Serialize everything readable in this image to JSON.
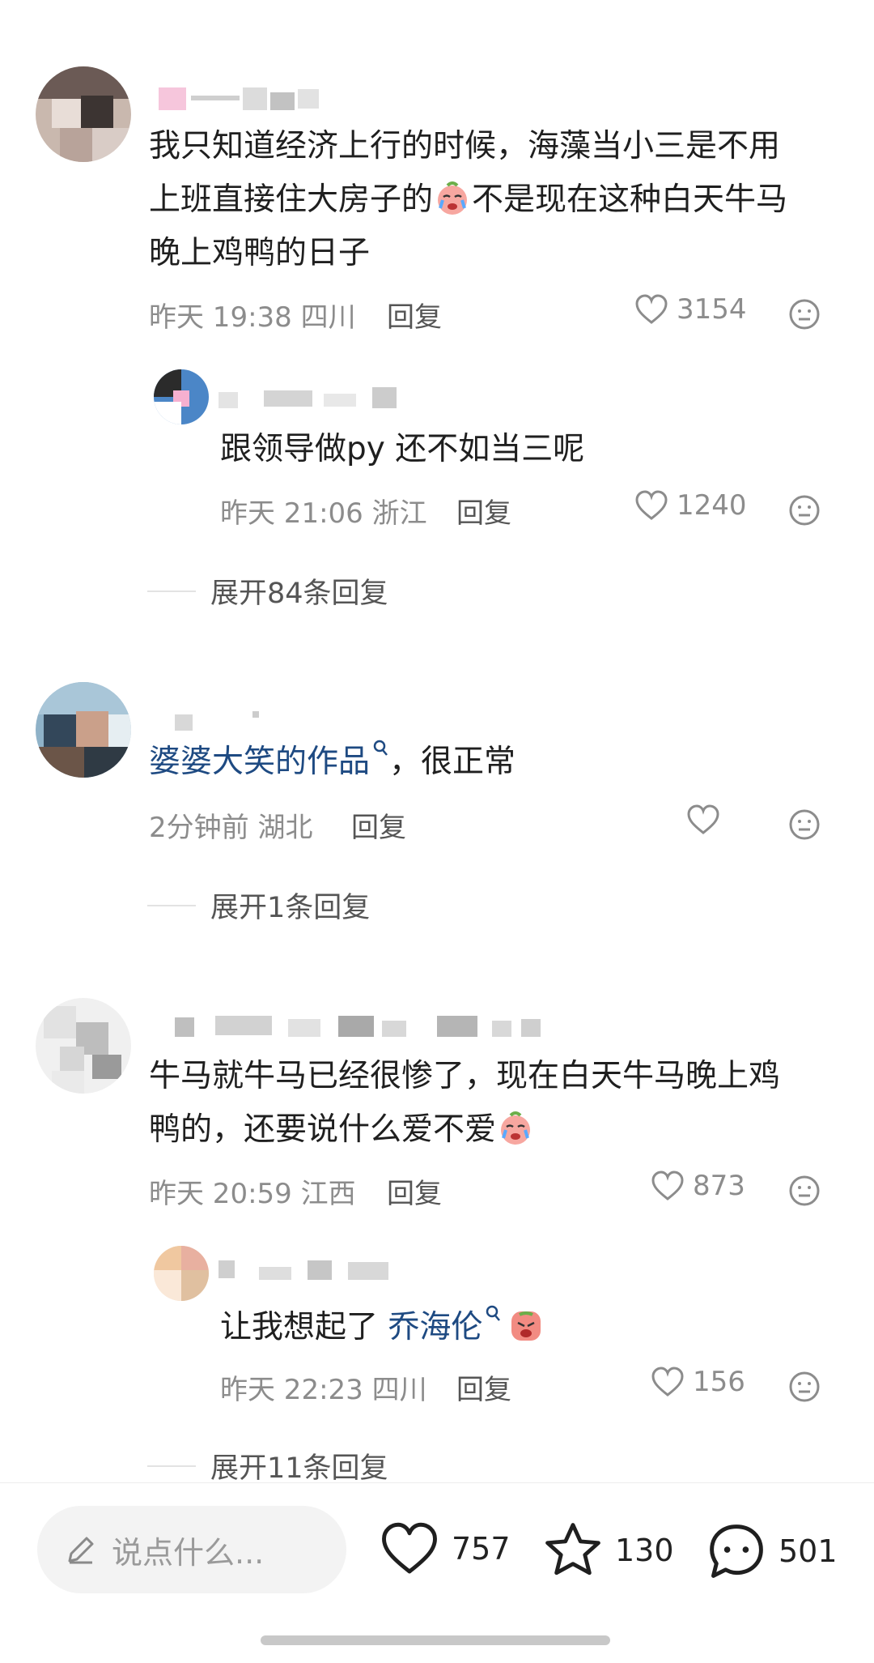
{
  "comments": [
    {
      "text_lines": [
        "我只知道经济上行的时候，海藻当小三是不用",
        "上班直接住大房子的",
        "不是现在这种白天牛马",
        "晚上鸡鸭的日子"
      ],
      "time": "昨天 19:38",
      "location": "四川",
      "reply_label": "回复",
      "likes": "3154",
      "replies": [
        {
          "text": "跟领导做py 还不如当三呢",
          "time": "昨天 21:06",
          "location": "浙江",
          "reply_label": "回复",
          "likes": "1240"
        }
      ],
      "expand_label": "展开84条回复"
    },
    {
      "link_text": "婆婆大笑的作品",
      "text_suffix": "，很正常",
      "time": "2分钟前",
      "location": "湖北",
      "reply_label": "回复",
      "likes": "",
      "expand_label": "展开1条回复"
    },
    {
      "text_lines": [
        "牛马就牛马已经很惨了，现在白天牛马晚上鸡",
        "鸭的，还要说什么爱不爱"
      ],
      "time": "昨天 20:59",
      "location": "江西",
      "reply_label": "回复",
      "likes": "873",
      "replies": [
        {
          "text_prefix": "让我想起了 ",
          "link_text": "乔海伦",
          "time": "昨天 22:23",
          "location": "四川",
          "reply_label": "回复",
          "likes": "156"
        }
      ],
      "expand_label": "展开11条回复"
    }
  ],
  "bottom_bar": {
    "input_placeholder": "说点什么...",
    "like_count": "757",
    "favorite_count": "130",
    "comment_count": "501"
  },
  "colors": {
    "link": "#1e4a82",
    "meta": "#8c8c8c",
    "text": "#1f1f1f"
  }
}
